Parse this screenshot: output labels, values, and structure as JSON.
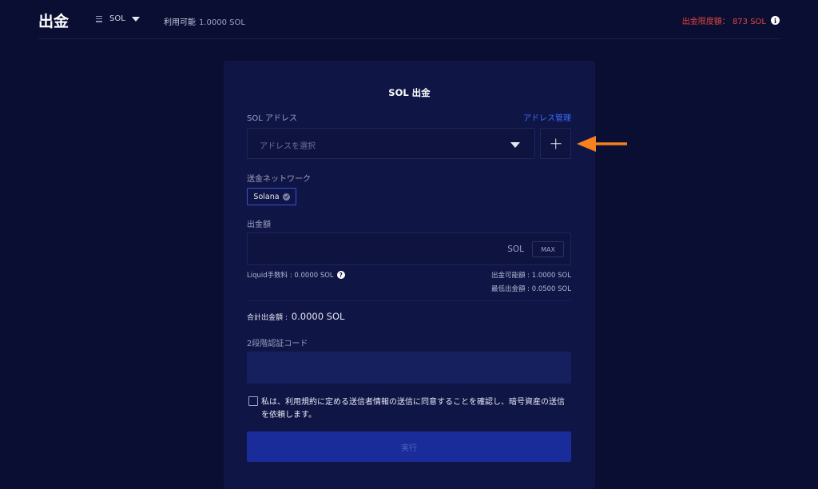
{
  "header": {
    "title": "出金",
    "currency": "SOL",
    "available_label": "利用可能",
    "available_value": "1.0000 SOL",
    "limit_text": "出金限度額： 873 SOL",
    "info_icon": "i"
  },
  "form": {
    "title": "SOL 出金",
    "address_label": "SOL アドレス",
    "address_manage": "アドレス管理",
    "address_placeholder": "アドレスを選択",
    "network_label": "送金ネットワーク",
    "network_value": "Solana",
    "amount_label": "出金額",
    "amount_unit": "SOL",
    "max_label": "MAX",
    "fee_text": "Liquid手数料 : 0.0000 SOL",
    "help_icon": "?",
    "withdrawable_text": "出金可能額 : 1.0000 SOL",
    "minimum_text": "最低出金額 : 0.0500 SOL",
    "total_label": "合計出金額 :",
    "total_value": "0.0000 SOL",
    "twofa_label": "2段階認証コード",
    "agree_text": "私は、利用規約に定める送信者情報の送信に同意することを確認し、暗号資産の送信を依頼します。",
    "submit_label": "実行"
  },
  "colors": {
    "background": "#0b0e33",
    "card": "#0f1545",
    "accent": "#3d6cff",
    "limit_red": "#e0453e",
    "arrow_orange": "#f5821f"
  }
}
